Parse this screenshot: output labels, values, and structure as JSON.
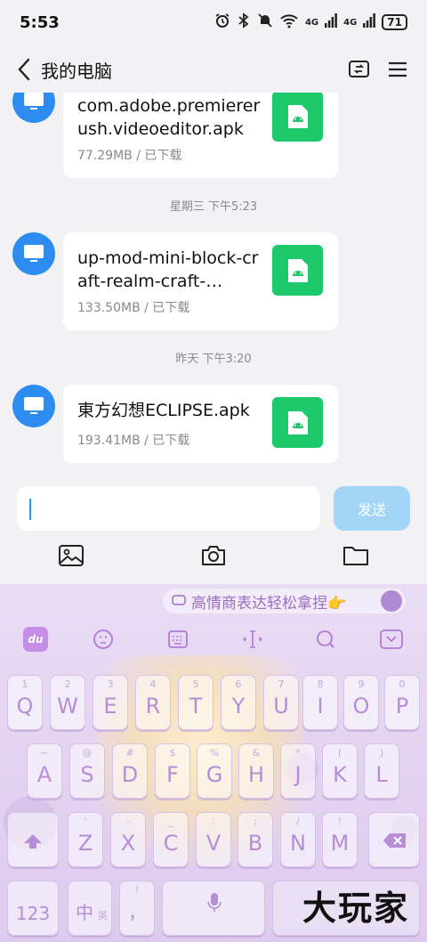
{
  "status_bar": {
    "time": "5:53",
    "wifi_label": "6",
    "signal_1": "4G",
    "signal_2": "4G",
    "battery": "71"
  },
  "header": {
    "title": "我的电脑"
  },
  "messages": [
    {
      "file_name": "com.adobe.premiererush.videoeditor.apk",
      "size": "77.29MB",
      "status": "已下载"
    },
    {
      "timestamp": "星期三 下午5:23"
    },
    {
      "file_name": "up-mod-mini-block-craft-realm-craft-…",
      "size": "133.50MB",
      "status": "已下载"
    },
    {
      "timestamp": "昨天 下午3:20"
    },
    {
      "file_name": "東方幻想ECLIPSE.apk",
      "size": "193.41MB",
      "status": "已下载"
    }
  ],
  "input": {
    "value": "",
    "send_label": "发送"
  },
  "keyboard": {
    "suggestion": "高情商表达轻松拿捏👉",
    "logo_text": "du",
    "row1": [
      {
        "key": "Q",
        "sub": "1"
      },
      {
        "key": "W",
        "sub": "2"
      },
      {
        "key": "E",
        "sub": "3"
      },
      {
        "key": "R",
        "sub": "4"
      },
      {
        "key": "T",
        "sub": "5"
      },
      {
        "key": "Y",
        "sub": "6"
      },
      {
        "key": "U",
        "sub": "7"
      },
      {
        "key": "I",
        "sub": "8"
      },
      {
        "key": "O",
        "sub": "9"
      },
      {
        "key": "P",
        "sub": "0"
      }
    ],
    "row2": [
      {
        "key": "A",
        "sub": "~"
      },
      {
        "key": "S",
        "sub": "@"
      },
      {
        "key": "D",
        "sub": "#"
      },
      {
        "key": "F",
        "sub": "$"
      },
      {
        "key": "G",
        "sub": "%"
      },
      {
        "key": "H",
        "sub": "&"
      },
      {
        "key": "J",
        "sub": "*"
      },
      {
        "key": "K",
        "sub": "("
      },
      {
        "key": "L",
        "sub": ")"
      }
    ],
    "row3": [
      {
        "key": "Z",
        "sub": "'"
      },
      {
        "key": "X",
        "sub": "-"
      },
      {
        "key": "C",
        "sub": "_"
      },
      {
        "key": "V",
        "sub": ":"
      },
      {
        "key": "B",
        "sub": ";"
      },
      {
        "key": "N",
        "sub": "/"
      },
      {
        "key": "M",
        "sub": "!"
      }
    ],
    "numbers_key": "123",
    "lang_key": "中",
    "lang_sub": "英",
    "punct_key": "，",
    "punct_sub": "!"
  },
  "watermark": "大玩家",
  "colors": {
    "accent": "#2d8cf0",
    "file_green": "#1ec96b",
    "send_disabled": "#a3d5f7",
    "keyboard_bg": "#e2d1f1",
    "key_text": "#b58ed6"
  }
}
